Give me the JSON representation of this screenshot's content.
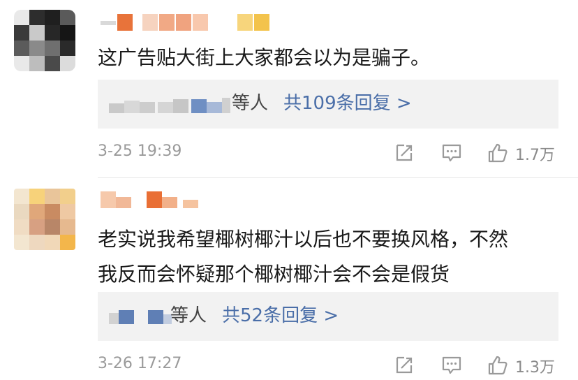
{
  "comments": [
    {
      "text": "这广告贴大街上大家都会以为是骗子。",
      "reply_suffix": "等人",
      "reply_link": "共109条回复 >",
      "time": "3-25 19:39",
      "likes": "1.7万",
      "icons": [
        "share-icon",
        "comment-icon",
        "thumbs-up-icon"
      ]
    },
    {
      "text_line1": "老实说我希望椰树椰汁以后也不要换风格，不然",
      "text_line2": "我反而会怀疑那个椰树椰汁会不会是假货",
      "reply_suffix": "等人",
      "reply_link": "共52条回复 >",
      "time": "3-26 17:27",
      "likes": "1.3万",
      "icons": [
        "share-icon",
        "comment-icon",
        "thumbs-up-icon"
      ]
    }
  ],
  "colors": {
    "link": "#4a6ea8",
    "meta_text": "#9a9a9a",
    "reply_bg": "#f2f2f2",
    "divider": "#e8e8e8"
  }
}
